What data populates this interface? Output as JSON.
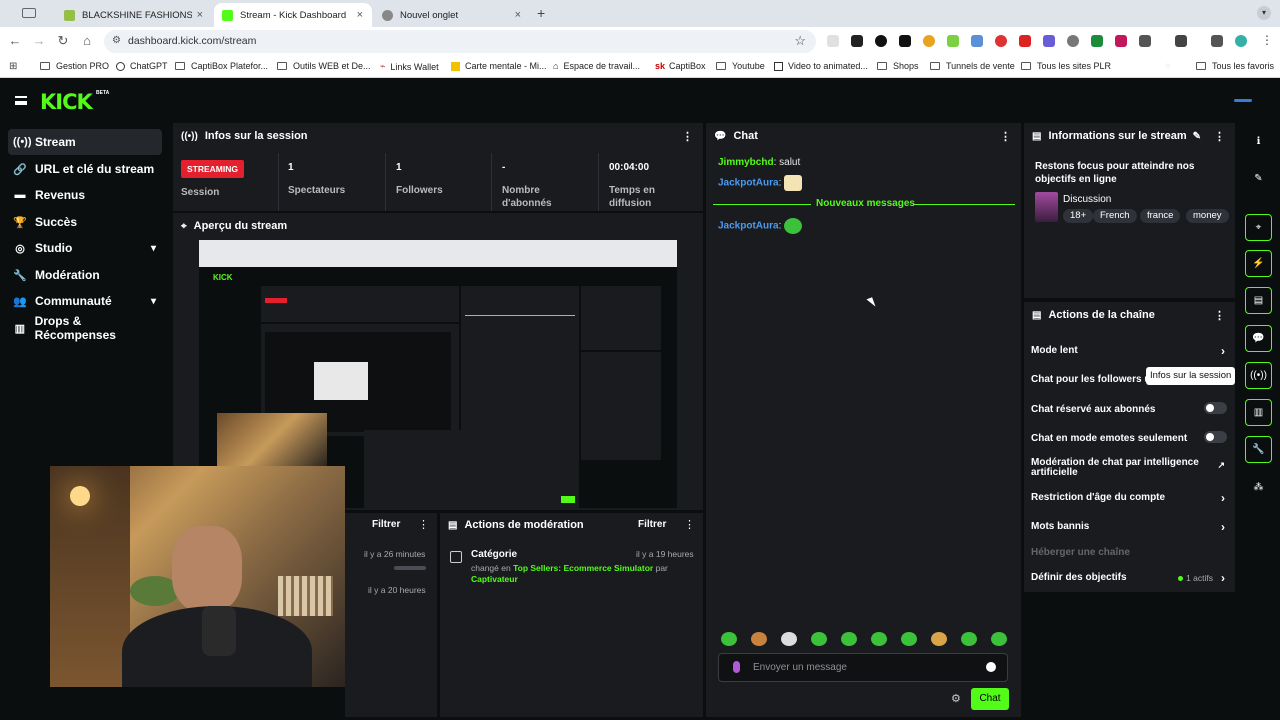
{
  "browser": {
    "tabs": [
      {
        "title": "BLACKSHINE FASHIONS - Mo",
        "color": "#95bf47"
      },
      {
        "title": "Stream - Kick Dashboard",
        "color": "#53fc18"
      },
      {
        "title": "Nouvel onglet",
        "color": "#777777"
      }
    ],
    "url": "dashboard.kick.com/stream",
    "bookmarks": [
      "Gestion PRO",
      "ChatGPT",
      "CaptiBox Platefor...",
      "Outils WEB et De...",
      "Links Wallet",
      "Carte mentale - Mi...",
      "Espace de travail...",
      "CaptiBox",
      "Youtube",
      "Video to animated...",
      "Shops",
      "Tunnels de vente",
      "Tous les sites PLR",
      "Tous les favoris"
    ]
  },
  "sidebar": {
    "items": [
      {
        "label": "Stream",
        "icon": "broadcast-icon"
      },
      {
        "label": "URL et clé du stream",
        "icon": "link-icon"
      },
      {
        "label": "Revenus",
        "icon": "money-icon"
      },
      {
        "label": "Succès",
        "icon": "trophy-icon"
      },
      {
        "label": "Studio",
        "icon": "palette-icon"
      },
      {
        "label": "Modération",
        "icon": "wrench-icon"
      },
      {
        "label": "Communauté",
        "icon": "people-icon"
      },
      {
        "label": "Drops & Récompenses",
        "icon": "gift-icon"
      }
    ]
  },
  "session": {
    "title": "Infos sur la session",
    "status_badge": "STREAMING",
    "status_label": "Session",
    "viewers_value": "1",
    "viewers_label": "Spectateurs",
    "followers_value": "1",
    "followers_label": "Followers",
    "subs_value": "-",
    "subs_label": "Nombre d'abonnés",
    "time_value": "00:04:00",
    "time_label": "Temps en diffusion"
  },
  "preview": {
    "title": "Aperçu du stream"
  },
  "events": {
    "filter": "Filtrer",
    "items": [
      "il y a 26 minutes",
      "il y a 20 heures"
    ]
  },
  "moderation": {
    "title": "Actions de modération",
    "filter": "Filtrer",
    "entry_title": "Catégorie",
    "entry_time": "il y a 19 heures",
    "entry_prefix": "changé en",
    "entry_link": "Top Sellers: Ecommerce Simulator",
    "entry_mid": "par",
    "entry_user": "Captivateur"
  },
  "chat": {
    "title": "Chat",
    "messages": [
      {
        "user": "Jimmybchd",
        "text": "salut"
      },
      {
        "user": "JackpotAura",
        "text": ""
      }
    ],
    "new_messages": "Nouveaux messages",
    "after": {
      "user": "JackpotAura"
    },
    "placeholder": "Envoyer un message",
    "send": "Chat"
  },
  "stream_info": {
    "title": "Informations sur le stream",
    "stream_title": "Restons focus pour atteindre nos objectifs en ligne",
    "category": "Discussion",
    "tags": [
      "18+",
      "French",
      "france",
      "money"
    ]
  },
  "channel_actions": {
    "title": "Actions de la chaîne",
    "rows": [
      "Mode lent",
      "Chat pour les followers un",
      "Chat réservé aux abonnés",
      "Chat en mode emotes seulement",
      "Modération de chat par intelligence artificielle",
      "Restriction d'âge du compte",
      "Mots bannis",
      "Héberger une chaîne",
      "Définir des objectifs"
    ],
    "goals_count": "1 actifs",
    "tooltip": "Infos sur la session"
  },
  "colors": {
    "accent": "#53fc18",
    "danger": "#e5202e",
    "panel": "#191b1f"
  }
}
